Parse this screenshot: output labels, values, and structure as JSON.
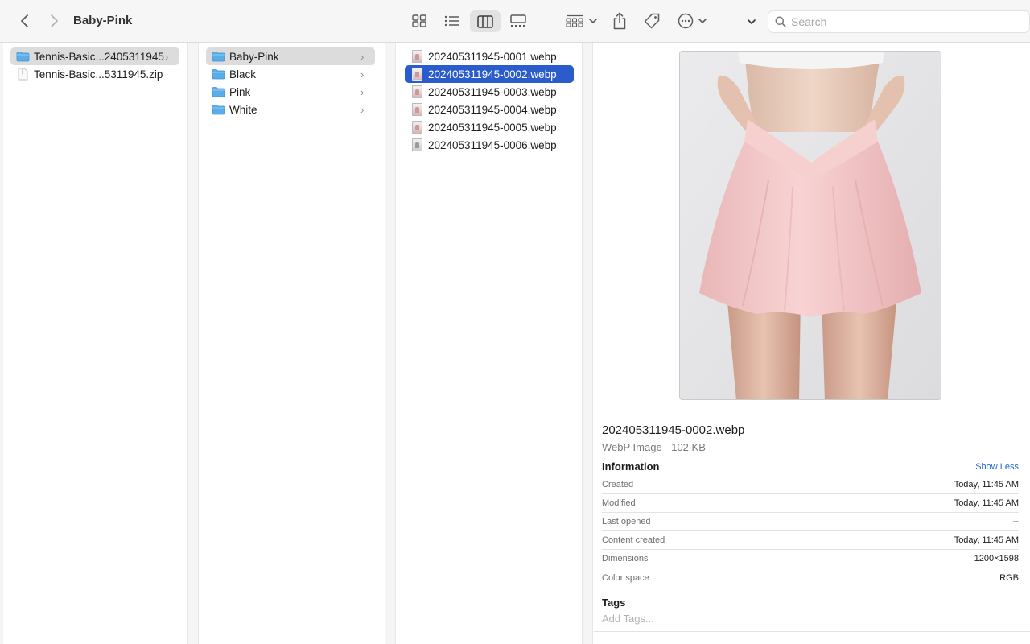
{
  "window": {
    "title": "Baby-Pink"
  },
  "search": {
    "placeholder": "Search"
  },
  "columns": {
    "col1": [
      {
        "label": "Tennis-Basic...2405311945",
        "kind": "folder",
        "selected": true
      },
      {
        "label": "Tennis-Basic...5311945.zip",
        "kind": "zip",
        "selected": false
      }
    ],
    "col2": [
      {
        "label": "Baby-Pink",
        "kind": "folder",
        "selected": true
      },
      {
        "label": "Black",
        "kind": "folder",
        "selected": false
      },
      {
        "label": "Pink",
        "kind": "folder",
        "selected": false
      },
      {
        "label": "White",
        "kind": "folder",
        "selected": false
      }
    ],
    "col3": [
      {
        "label": "202405311945-0001.webp"
      },
      {
        "label": "202405311945-0002.webp",
        "selected": true
      },
      {
        "label": "202405311945-0003.webp"
      },
      {
        "label": "202405311945-0004.webp"
      },
      {
        "label": "202405311945-0005.webp"
      },
      {
        "label": "202405311945-0006.webp"
      }
    ]
  },
  "preview": {
    "file_name": "202405311945-0002.webp",
    "file_kind": "WebP Image - 102 KB",
    "info_title": "Information",
    "show_less": "Show Less",
    "info": [
      {
        "key": "Created",
        "value": "Today, 11:45 AM"
      },
      {
        "key": "Modified",
        "value": "Today, 11:45 AM"
      },
      {
        "key": "Last opened",
        "value": "--"
      },
      {
        "key": "Content created",
        "value": "Today, 11:45 AM"
      },
      {
        "key": "Dimensions",
        "value": "1200×1598"
      },
      {
        "key": "Color space",
        "value": "RGB"
      }
    ],
    "tags_title": "Tags",
    "tags_placeholder": "Add Tags..."
  },
  "colors": {
    "accent": "#2a5ccc",
    "selection_grey": "#dcdcdc",
    "link": "#1e63d6",
    "folder": "#5aaee8"
  }
}
